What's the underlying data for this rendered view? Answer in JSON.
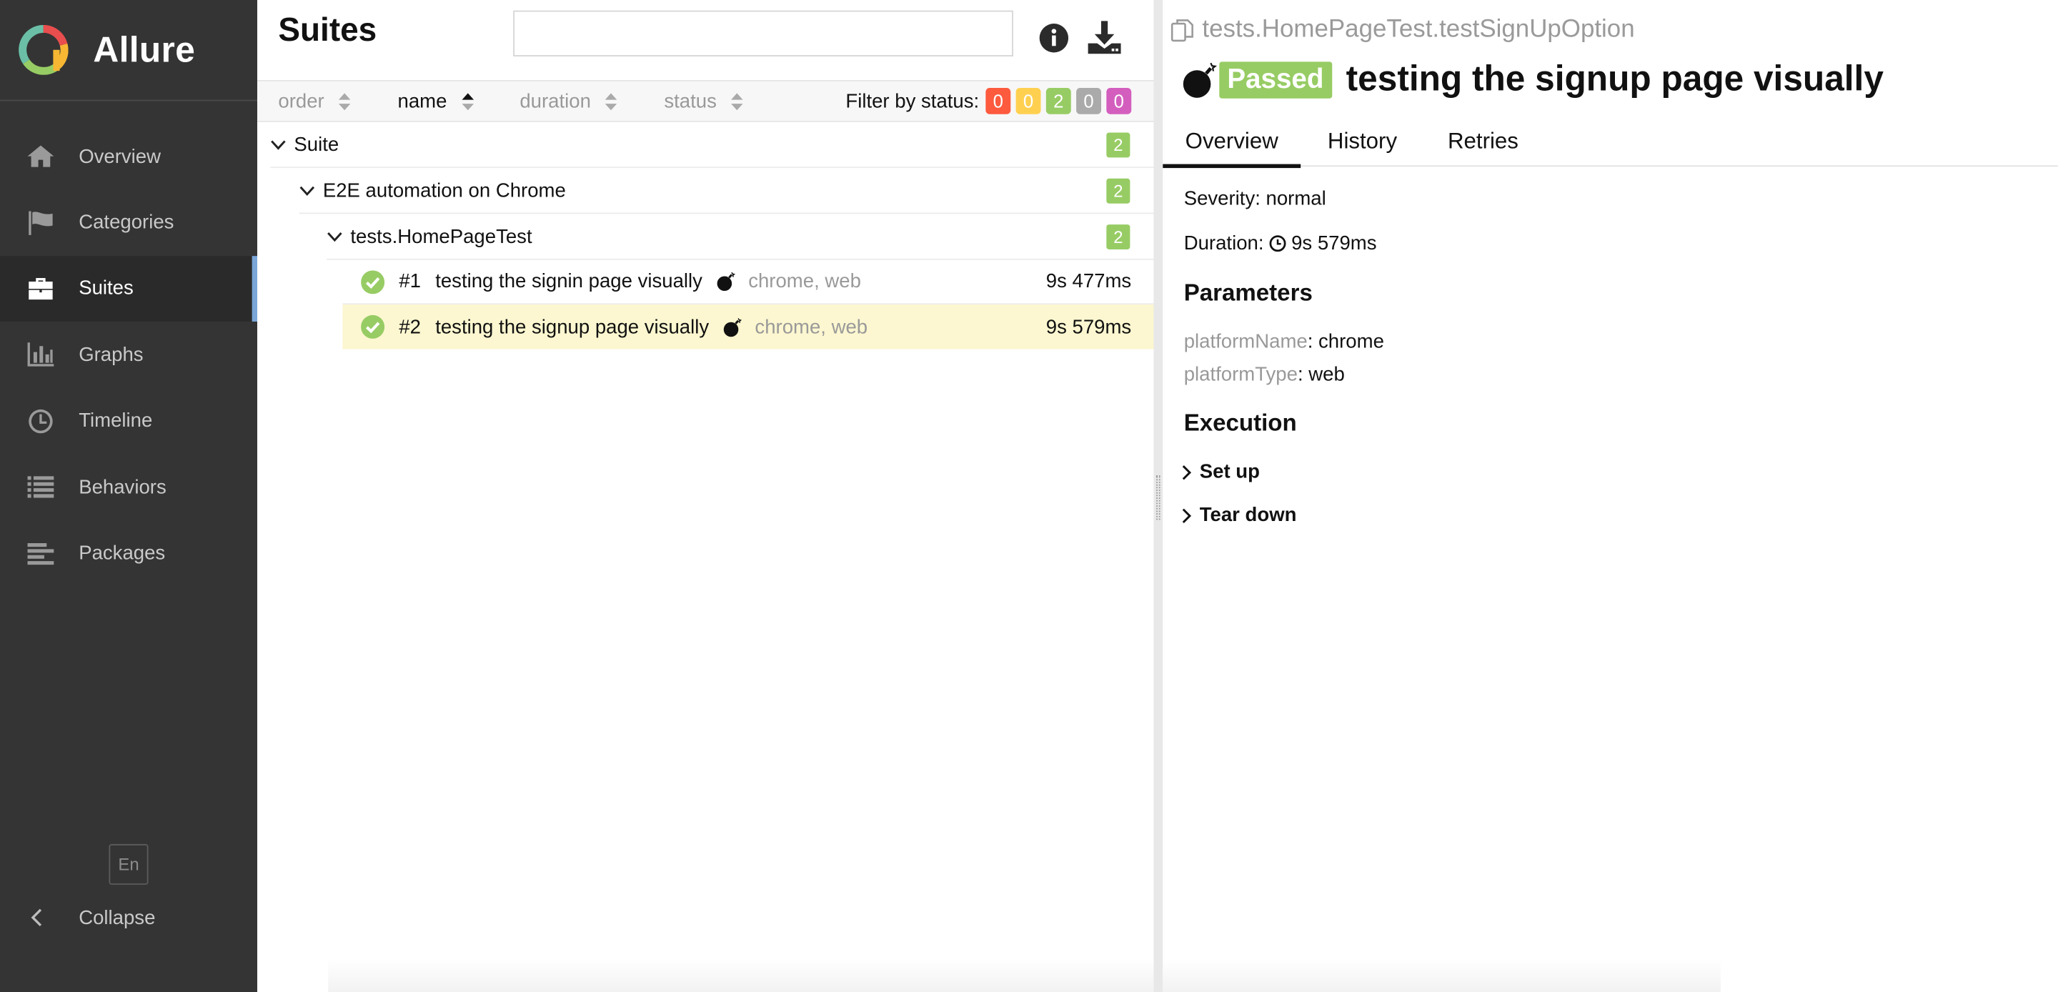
{
  "brand": {
    "name": "Allure"
  },
  "sidebar": {
    "items": [
      {
        "label": "Overview",
        "icon": "home-icon"
      },
      {
        "label": "Categories",
        "icon": "flag-icon"
      },
      {
        "label": "Suites",
        "icon": "briefcase-icon",
        "active": true
      },
      {
        "label": "Graphs",
        "icon": "bar-chart-icon"
      },
      {
        "label": "Timeline",
        "icon": "clock-icon"
      },
      {
        "label": "Behaviors",
        "icon": "list-icon"
      },
      {
        "label": "Packages",
        "icon": "align-left-icon"
      }
    ],
    "language": "En",
    "collapse_label": "Collapse"
  },
  "suites_panel": {
    "title": "Suites",
    "search_placeholder": "",
    "sort": {
      "order": "order",
      "name": "name",
      "duration": "duration",
      "status": "status"
    },
    "filter": {
      "label": "Filter by status:",
      "counts": [
        {
          "value": "0",
          "color": "#fd5a3e"
        },
        {
          "value": "0",
          "color": "#ffd050"
        },
        {
          "value": "2",
          "color": "#97cc64"
        },
        {
          "value": "0",
          "color": "#aaaaaa"
        },
        {
          "value": "0",
          "color": "#d35ebe"
        }
      ]
    },
    "tree": {
      "suite": {
        "name": "Suite",
        "count": "2"
      },
      "group": {
        "name": "E2E automation on Chrome",
        "count": "2"
      },
      "class": {
        "name": "tests.HomePageTest",
        "count": "2"
      },
      "tests": [
        {
          "num": "#1",
          "name": "testing the signin page visually",
          "params": "chrome, web",
          "duration": "9s 477ms",
          "selected": false
        },
        {
          "num": "#2",
          "name": "testing the signup page visually",
          "params": "chrome, web",
          "duration": "9s 579ms",
          "selected": true
        }
      ]
    }
  },
  "details": {
    "breadcrumb": "tests.HomePageTest.testSignUpOption",
    "status": "Passed",
    "title": "testing the signup page visually",
    "tabs": [
      "Overview",
      "History",
      "Retries"
    ],
    "severity": "Severity: normal",
    "duration_label": "Duration:",
    "duration_value": "9s 579ms",
    "parameters_heading": "Parameters",
    "parameters": [
      {
        "key": "platformName",
        "value": ": chrome"
      },
      {
        "key": "platformType",
        "value": ": web"
      }
    ],
    "execution_heading": "Execution",
    "steps": [
      "Set up",
      "Tear down"
    ]
  },
  "colors": {
    "passed": "#97cc64",
    "sidebar_bg": "#343434",
    "selected_row": "#fcf7d0",
    "active_accent": "#7aa6d8"
  }
}
